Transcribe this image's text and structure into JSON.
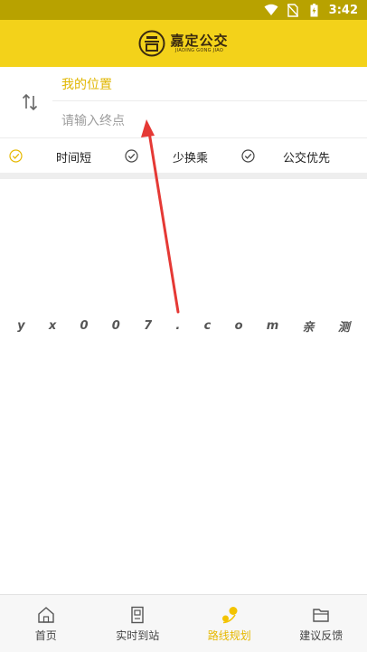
{
  "status_bar": {
    "time": "3:42",
    "icons": [
      "wifi-icon",
      "no-sim-icon",
      "battery-charging-icon"
    ]
  },
  "header": {
    "logo_cn": "嘉定公交",
    "logo_en": "JIADING GONG JIAO",
    "brand_color": "#f3d21a"
  },
  "route": {
    "origin_value": "我的位置",
    "destination_placeholder": "请输入终点",
    "swap_icon": "swap-arrows-icon"
  },
  "options": [
    {
      "label": "时间短",
      "selected": true
    },
    {
      "label": "少换乘",
      "selected": false
    },
    {
      "label": "公交优先",
      "selected": false
    }
  ],
  "watermark": [
    "y",
    "x",
    "0",
    "0",
    "7",
    ".",
    "c",
    "o",
    "m",
    "亲",
    "测"
  ],
  "tabs": [
    {
      "label": "首页",
      "icon": "home-icon",
      "active": false
    },
    {
      "label": "实时到站",
      "icon": "bus-stop-icon",
      "active": false
    },
    {
      "label": "路线规划",
      "icon": "route-plan-icon",
      "active": true
    },
    {
      "label": "建议反馈",
      "icon": "feedback-icon",
      "active": false
    }
  ],
  "colors": {
    "accent": "#e6b800",
    "status_bar": "#b8a200",
    "annotation_arrow": "#e53935"
  }
}
